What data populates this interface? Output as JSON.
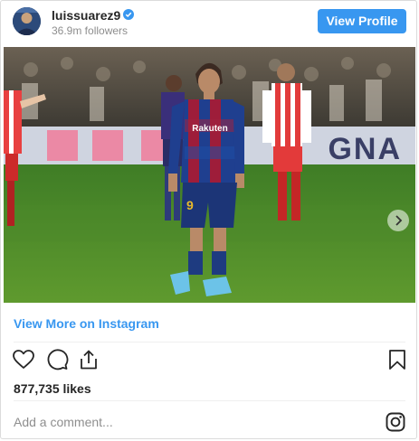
{
  "header": {
    "username": "luissuarez9",
    "followers": "36.9m followers",
    "view_profile_label": "View Profile",
    "verified_icon": "verified-badge-icon"
  },
  "media": {
    "next_icon": "chevron-right-icon",
    "board_text": "GNA",
    "shirt_text": "Rakuten",
    "player_number": "9"
  },
  "view_more_label": "View More on Instagram",
  "actions": {
    "like_icon": "heart-icon",
    "comment_icon": "comment-icon",
    "share_icon": "share-icon",
    "save_icon": "bookmark-icon"
  },
  "likes": "877,735 likes",
  "comment": {
    "placeholder": "Add a comment..."
  },
  "footer_icon": "instagram-icon",
  "colors": {
    "accent": "#3897f0",
    "text": "#262626",
    "muted": "#8e8e8e"
  }
}
